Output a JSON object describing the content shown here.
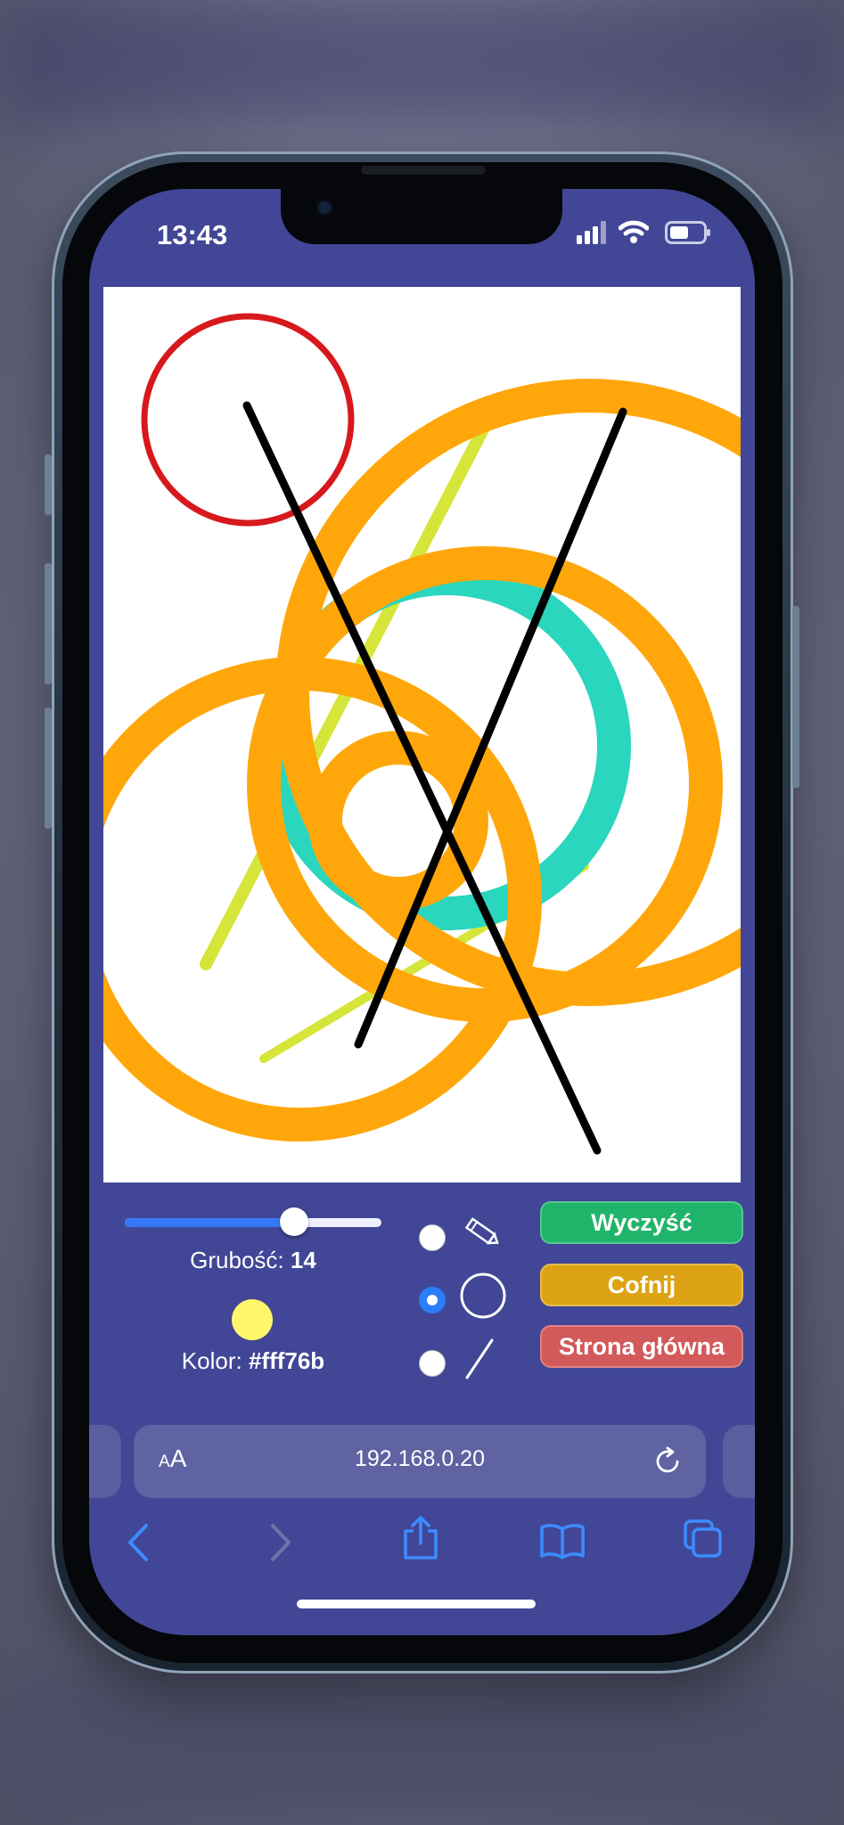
{
  "status_bar": {
    "time": "13:43"
  },
  "canvas": {
    "background": "#ffffff",
    "strokes": [
      {
        "shape": "circle",
        "color": "#d7191e"
      },
      {
        "shape": "line",
        "color": "#d6e53a"
      },
      {
        "shape": "line",
        "color": "#d6e53a"
      },
      {
        "shape": "circle",
        "color": "#2ad6bd"
      },
      {
        "shape": "circle",
        "color": "#ffa70a"
      },
      {
        "shape": "circle",
        "color": "#ffa70a"
      },
      {
        "shape": "circle",
        "color": "#ffa70a"
      },
      {
        "shape": "circle",
        "color": "#ffa70a"
      },
      {
        "shape": "line",
        "color": "#000000"
      },
      {
        "shape": "line",
        "color": "#000000"
      }
    ]
  },
  "controls": {
    "thickness_label": "Grubość:",
    "thickness_value": "14",
    "thickness_fraction": 0.66,
    "color_label": "Kolor:",
    "color_value": "#fff76b",
    "tools": [
      {
        "name": "pencil",
        "icon": "pencil-icon",
        "selected": false
      },
      {
        "name": "circle",
        "icon": "circle-icon",
        "selected": true
      },
      {
        "name": "line",
        "icon": "line-icon",
        "selected": false
      }
    ],
    "buttons": {
      "clear": {
        "label": "Wyczyść",
        "color": "#20b46a"
      },
      "undo": {
        "label": "Cofnij",
        "color": "#dca414"
      },
      "home": {
        "label": "Strona główna",
        "color": "#d25a5a"
      }
    }
  },
  "browser": {
    "text_size_label": "AA",
    "url": "192.168.0.20",
    "toolbar": [
      "back-icon",
      "forward-icon",
      "share-icon",
      "bookmarks-icon",
      "tabs-icon"
    ]
  }
}
